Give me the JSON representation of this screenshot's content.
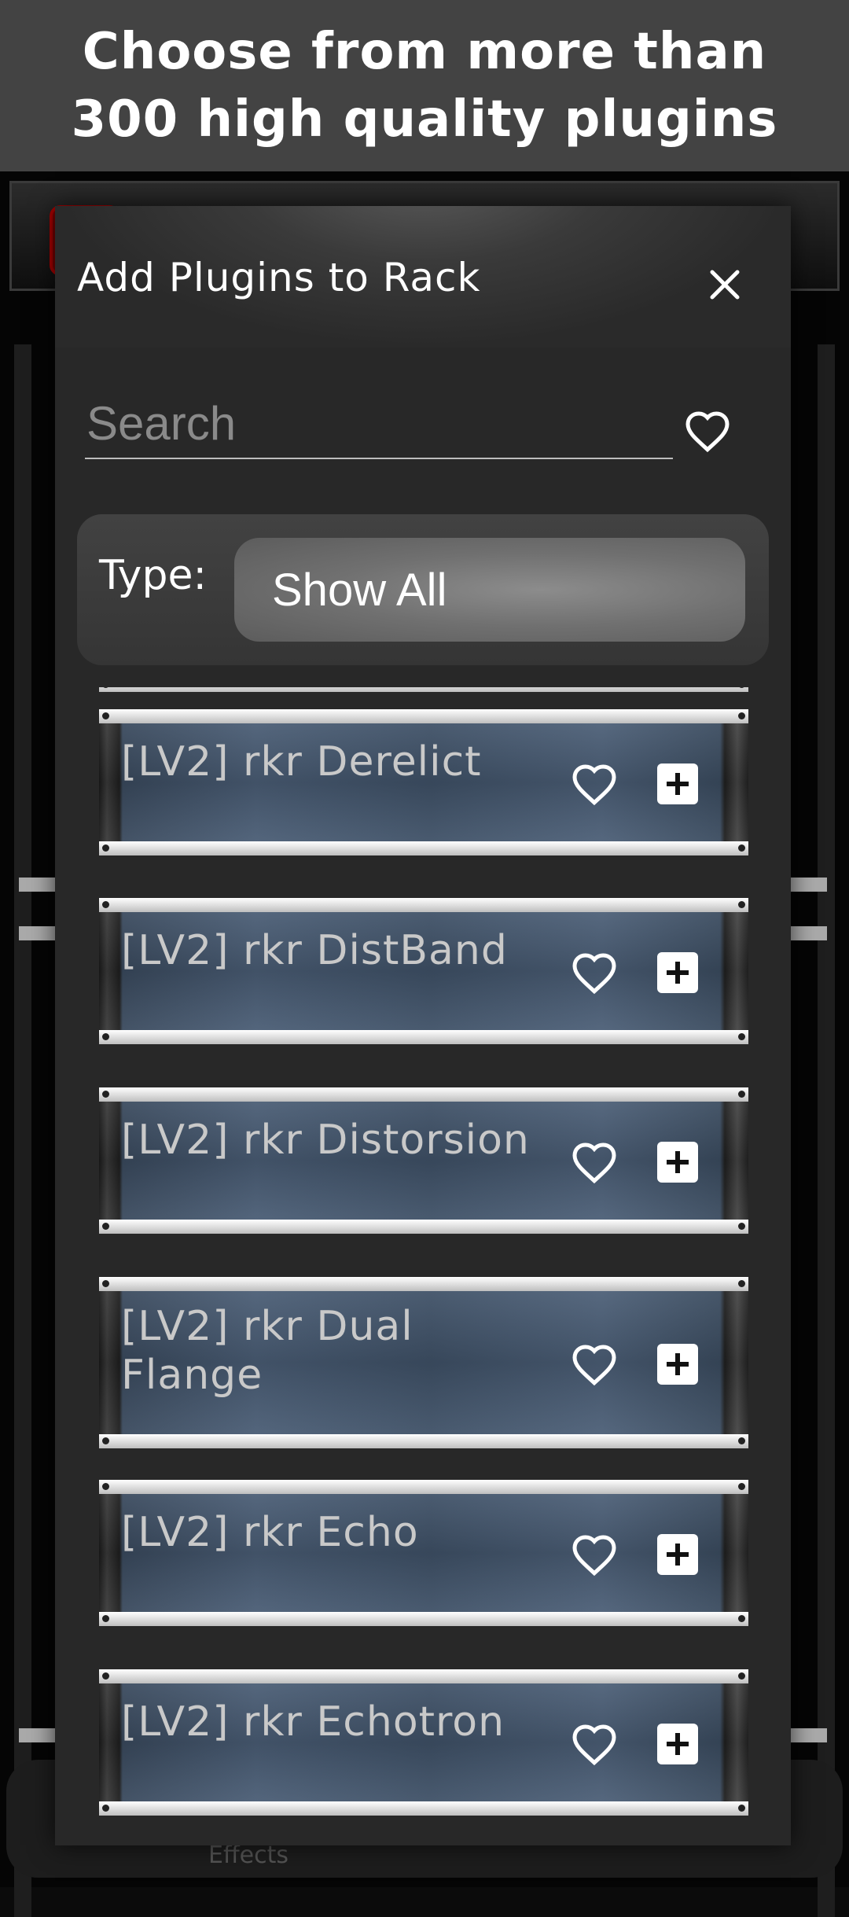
{
  "banner": {
    "line1": "Choose from more than",
    "line2": "300 high quality plugins"
  },
  "background": {
    "bottom_tab_label": "Effects"
  },
  "modal": {
    "title": "Add Plugins to Rack",
    "close_icon": "close-icon",
    "search": {
      "placeholder": "Search",
      "value": ""
    },
    "favorites_filter_icon": "heart-outline-icon",
    "type_filter": {
      "label": "Type:",
      "selected": "Show All"
    },
    "plugins": [
      {
        "name": "[LV2] rkr Derelict"
      },
      {
        "name": "[LV2] rkr DistBand"
      },
      {
        "name": "[LV2] rkr Distorsion"
      },
      {
        "name": "[LV2] rkr Dual Flange"
      },
      {
        "name": "[LV2] rkr Echo"
      },
      {
        "name": "[LV2] rkr Echotron"
      }
    ]
  },
  "colors": {
    "banner_bg": "#434343",
    "modal_bg": "#282828",
    "plate_blue": "#4a5d75"
  }
}
